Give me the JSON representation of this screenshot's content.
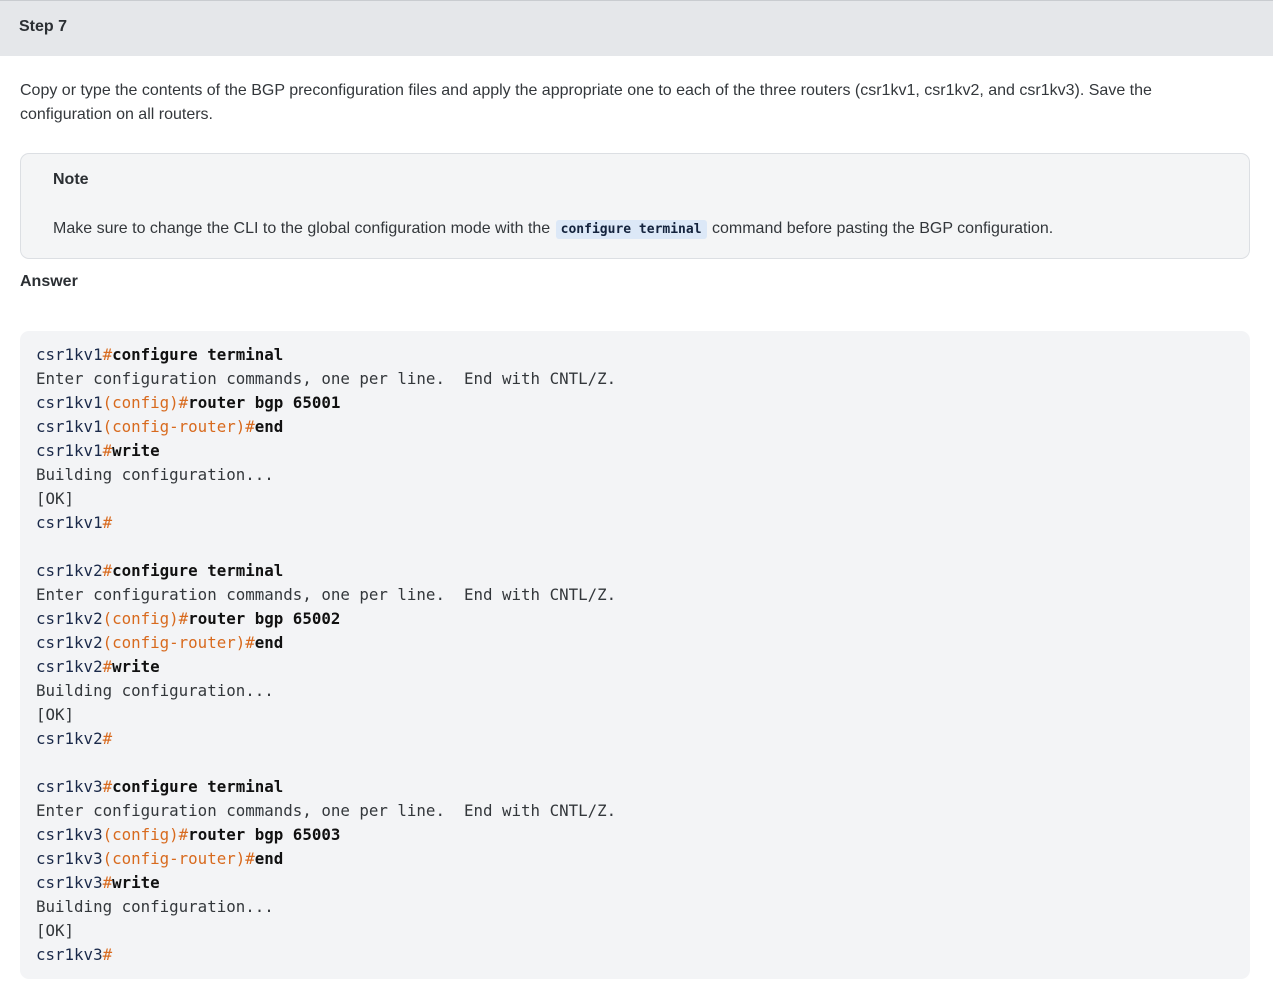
{
  "step": {
    "title": "Step 7"
  },
  "intro": {
    "text": "Copy or type the contents of the BGP preconfiguration files and apply the appropriate one to each of the three routers (csr1kv1, csr1kv2, and csr1kv3). Save the configuration on all routers."
  },
  "note": {
    "title": "Note",
    "text_before": "Make sure to change the CLI to the global configuration mode with the",
    "code": "configure terminal",
    "text_after": "command before pasting the BGP configuration."
  },
  "answer": {
    "title": "Answer"
  },
  "code": {
    "lines": [
      [
        {
          "t": "csr1kv1",
          "c": "host"
        },
        {
          "t": "#",
          "c": "hash"
        },
        {
          "t": "configure terminal",
          "c": "cmd"
        }
      ],
      [
        {
          "t": "Enter configuration commands, one per line.  End with CNTL/Z.",
          "c": "out"
        }
      ],
      [
        {
          "t": "csr1kv1",
          "c": "host"
        },
        {
          "t": "(config)#",
          "c": "mode"
        },
        {
          "t": "router bgp 65001",
          "c": "cmd"
        }
      ],
      [
        {
          "t": "csr1kv1",
          "c": "host"
        },
        {
          "t": "(config-router)#",
          "c": "mode"
        },
        {
          "t": "end",
          "c": "cmd"
        }
      ],
      [
        {
          "t": "csr1kv1",
          "c": "host"
        },
        {
          "t": "#",
          "c": "hash"
        },
        {
          "t": "write",
          "c": "cmd"
        }
      ],
      [
        {
          "t": "Building configuration...",
          "c": "out"
        }
      ],
      [
        {
          "t": "[OK]",
          "c": "out"
        }
      ],
      [
        {
          "t": "csr1kv1",
          "c": "host"
        },
        {
          "t": "#",
          "c": "hash"
        }
      ],
      [],
      [
        {
          "t": "csr1kv2",
          "c": "host"
        },
        {
          "t": "#",
          "c": "hash"
        },
        {
          "t": "configure terminal",
          "c": "cmd"
        }
      ],
      [
        {
          "t": "Enter configuration commands, one per line.  End with CNTL/Z.",
          "c": "out"
        }
      ],
      [
        {
          "t": "csr1kv2",
          "c": "host"
        },
        {
          "t": "(config)#",
          "c": "mode"
        },
        {
          "t": "router bgp 65002",
          "c": "cmd"
        }
      ],
      [
        {
          "t": "csr1kv2",
          "c": "host"
        },
        {
          "t": "(config-router)#",
          "c": "mode"
        },
        {
          "t": "end",
          "c": "cmd"
        }
      ],
      [
        {
          "t": "csr1kv2",
          "c": "host"
        },
        {
          "t": "#",
          "c": "hash"
        },
        {
          "t": "write",
          "c": "cmd"
        }
      ],
      [
        {
          "t": "Building configuration...",
          "c": "out"
        }
      ],
      [
        {
          "t": "[OK]",
          "c": "out"
        }
      ],
      [
        {
          "t": "csr1kv2",
          "c": "host"
        },
        {
          "t": "#",
          "c": "hash"
        }
      ],
      [],
      [
        {
          "t": "csr1kv3",
          "c": "host"
        },
        {
          "t": "#",
          "c": "hash"
        },
        {
          "t": "configure terminal",
          "c": "cmd"
        }
      ],
      [
        {
          "t": "Enter configuration commands, one per line.  End with CNTL/Z.",
          "c": "out"
        }
      ],
      [
        {
          "t": "csr1kv3",
          "c": "host"
        },
        {
          "t": "(config)#",
          "c": "mode"
        },
        {
          "t": "router bgp 65003",
          "c": "cmd"
        }
      ],
      [
        {
          "t": "csr1kv3",
          "c": "host"
        },
        {
          "t": "(config-router)#",
          "c": "mode"
        },
        {
          "t": "end",
          "c": "cmd"
        }
      ],
      [
        {
          "t": "csr1kv3",
          "c": "host"
        },
        {
          "t": "#",
          "c": "hash"
        },
        {
          "t": "write",
          "c": "cmd"
        }
      ],
      [
        {
          "t": "Building configuration...",
          "c": "out"
        }
      ],
      [
        {
          "t": "[OK]",
          "c": "out"
        }
      ],
      [
        {
          "t": "csr1kv3",
          "c": "host"
        },
        {
          "t": "#",
          "c": "hash"
        }
      ]
    ]
  }
}
